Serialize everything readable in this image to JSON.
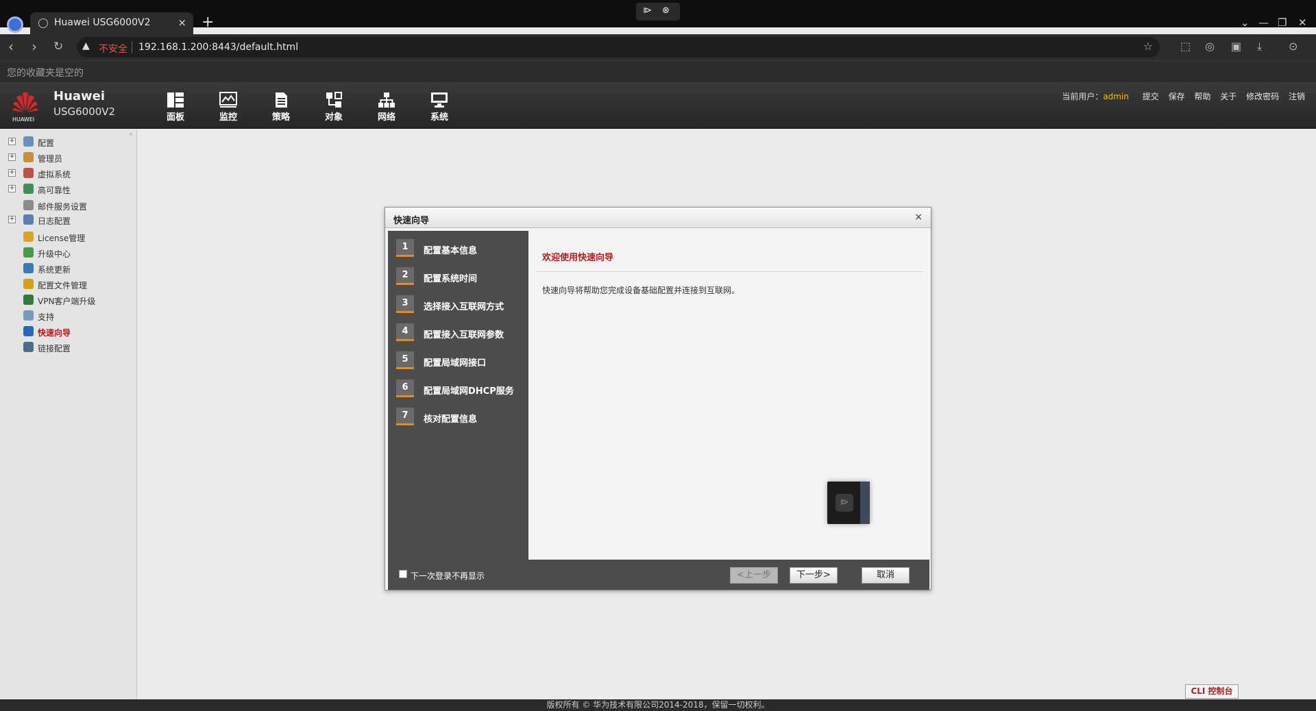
{
  "browser": {
    "tab_title": "Huawei USG6000V2",
    "new_tab": "+",
    "tab_close": "×",
    "insecure_label": "不安全",
    "url": "192.168.1.200:8443/default.html",
    "bookmarks_empty": "您的收藏夹是空的"
  },
  "header": {
    "brand_name": "Huawei",
    "brand_model": "USG6000V2",
    "logo_text": "HUAWEI",
    "nav": [
      {
        "label": "面板",
        "icon": "dashboard-icon"
      },
      {
        "label": "监控",
        "icon": "monitor-icon"
      },
      {
        "label": "策略",
        "icon": "policy-icon"
      },
      {
        "label": "对象",
        "icon": "object-icon"
      },
      {
        "label": "网络",
        "icon": "network-icon"
      },
      {
        "label": "系统",
        "icon": "system-icon"
      }
    ],
    "user_label": "当前用户：",
    "username": "admin",
    "links": [
      "提交",
      "保存",
      "帮助",
      "关于",
      "修改密码",
      "注销"
    ]
  },
  "sidebar": {
    "items": [
      {
        "label": "配置",
        "expandable": true,
        "color": "#6c8ebf"
      },
      {
        "label": "管理员",
        "expandable": true,
        "color": "#c9903a"
      },
      {
        "label": "虚拟系统",
        "expandable": true,
        "color": "#c0504d"
      },
      {
        "label": "高可靠性",
        "expandable": true,
        "color": "#3f8f5a"
      },
      {
        "label": "邮件服务设置",
        "expandable": false,
        "color": "#8a8a8a"
      },
      {
        "label": "日志配置",
        "expandable": true,
        "color": "#5b7fb0"
      },
      {
        "label": "License管理",
        "expandable": false,
        "color": "#d9a520"
      },
      {
        "label": "升级中心",
        "expandable": false,
        "color": "#4a9a4a"
      },
      {
        "label": "系统更新",
        "expandable": false,
        "color": "#3a7ab8"
      },
      {
        "label": "配置文件管理",
        "expandable": false,
        "color": "#d4a017"
      },
      {
        "label": "VPN客户端升级",
        "expandable": false,
        "color": "#2f7a3c"
      },
      {
        "label": "支持",
        "expandable": false,
        "color": "#7a99c0"
      },
      {
        "label": "快速向导",
        "expandable": false,
        "color": "#2766b8",
        "active": true
      },
      {
        "label": "链接配置",
        "expandable": false,
        "color": "#4d6a8f"
      }
    ]
  },
  "dialog": {
    "title": "快速向导",
    "close": "×",
    "steps": [
      {
        "num": "1",
        "label": "配置基本信息"
      },
      {
        "num": "2",
        "label": "配置系统时间"
      },
      {
        "num": "3",
        "label": "选择接入互联网方式"
      },
      {
        "num": "4",
        "label": "配置接入互联网参数"
      },
      {
        "num": "5",
        "label": "配置局域网接口"
      },
      {
        "num": "6",
        "label": "配置局域网DHCP服务"
      },
      {
        "num": "7",
        "label": "核对配置信息"
      }
    ],
    "welcome_title": "欢迎使用快速向导",
    "description": "快速向导将帮助您完成设备基础配置并连接到互联网。",
    "checkbox_label": "下一次登录不再显示",
    "prev_label": "<上一步",
    "next_label": "下一步>",
    "cancel_label": "取消"
  },
  "footer": {
    "copyright": "版权所有 © 华为技术有限公司2014-2018，保留一切权利。",
    "cli_label": "CLI 控制台"
  }
}
